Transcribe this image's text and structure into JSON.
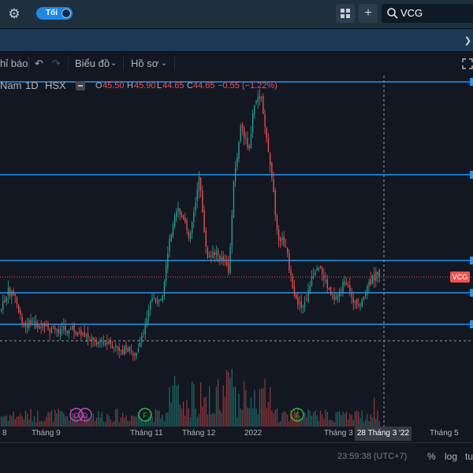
{
  "topbar": {
    "theme_toggle_label": "Tối",
    "search_value": "VCG",
    "add_label": "+"
  },
  "toolbar": {
    "indicators_label": "hỉ báo",
    "chart_type_label": "Biểu đồ",
    "profile_label": "Hồ sơ"
  },
  "legend": {
    "name": "Nam",
    "interval": "1D",
    "exchange": "HSX",
    "o_label": "O",
    "o_value": "45.50",
    "h_label": "H",
    "h_value": "45.90",
    "l_label": "L",
    "l_value": "44.65",
    "c_label": "C",
    "c_value": "44.65",
    "change": "−0.55 (−1.22%)"
  },
  "price_tag": "VCG",
  "x_axis": {
    "labels": [
      {
        "id": "lbl-8",
        "text": "8"
      },
      {
        "id": "lbl-sep",
        "text": "Tháng 9"
      },
      {
        "id": "lbl-nov",
        "text": "Tháng 11"
      },
      {
        "id": "lbl-dec",
        "text": "Tháng 12"
      },
      {
        "id": "lbl-2022",
        "text": "2022"
      },
      {
        "id": "lbl-mar",
        "text": "Tháng 3"
      },
      {
        "id": "lbl-may",
        "text": "Tháng 5"
      }
    ],
    "crosshair_label": "28 Tháng 3 '22"
  },
  "events": {
    "dividend_label": "D",
    "earnings_label": "F"
  },
  "bottombar": {
    "clock": "23:59:38 (UTC+7)",
    "percent": "%",
    "log": "log",
    "auto": "tu"
  },
  "colors": {
    "up": "#26a69a",
    "down": "#ef5350",
    "hline": "#2196f3",
    "dividend": "#c047c0",
    "earnings": "#2ebd40"
  }
}
